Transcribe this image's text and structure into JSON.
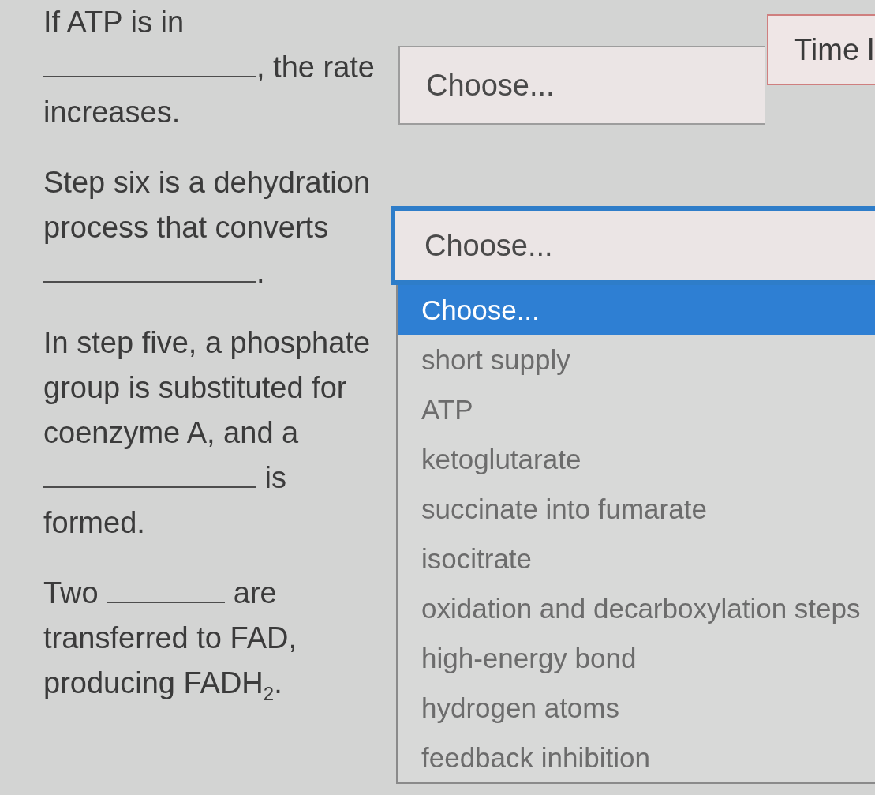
{
  "timer": {
    "label": "Time l"
  },
  "questions": [
    {
      "lines": [
        [
          {
            "kind": "text",
            "text": "If ATP is in"
          }
        ],
        [
          {
            "kind": "blank"
          },
          {
            "kind": "text",
            "text": ", the rate"
          }
        ],
        [
          {
            "kind": "text",
            "text": "increases."
          }
        ]
      ],
      "answer": {
        "value": "Choose...",
        "open": false
      }
    },
    {
      "lines": [
        [
          {
            "kind": "text",
            "text": "Step six is a dehydration"
          }
        ],
        [
          {
            "kind": "text",
            "text": "process that converts"
          }
        ],
        [
          {
            "kind": "blank"
          },
          {
            "kind": "text",
            "text": "."
          }
        ]
      ],
      "answer": {
        "value": "Choose...",
        "open": true,
        "options": [
          {
            "label": "Choose...",
            "selected": true
          },
          {
            "label": "short supply",
            "selected": false
          },
          {
            "label": "ATP",
            "selected": false
          },
          {
            "label": "ketoglutarate",
            "selected": false
          },
          {
            "label": "succinate into fumarate",
            "selected": false
          },
          {
            "label": "isocitrate",
            "selected": false
          },
          {
            "label": "oxidation and decarboxylation steps",
            "selected": false
          },
          {
            "label": "high-energy bond",
            "selected": false
          },
          {
            "label": "hydrogen atoms",
            "selected": false
          },
          {
            "label": "feedback inhibition",
            "selected": false
          }
        ]
      }
    },
    {
      "lines": [
        [
          {
            "kind": "text",
            "text": "In step five, a phosphate"
          }
        ],
        [
          {
            "kind": "text",
            "text": "group is substituted for"
          }
        ],
        [
          {
            "kind": "text",
            "text": "coenzyme A, and a"
          }
        ],
        [
          {
            "kind": "blank"
          },
          {
            "kind": "text",
            "text": " is"
          }
        ],
        [
          {
            "kind": "text",
            "text": "formed."
          }
        ]
      ]
    },
    {
      "lines": [
        [
          {
            "kind": "text",
            "text": "Two "
          },
          {
            "kind": "blank"
          },
          {
            "kind": "text",
            "text": " are"
          }
        ],
        [
          {
            "kind": "text",
            "text": "transferred to FAD,"
          }
        ],
        [
          {
            "kind": "text",
            "text": "producing FADH$_{2}$."
          }
        ]
      ]
    }
  ]
}
